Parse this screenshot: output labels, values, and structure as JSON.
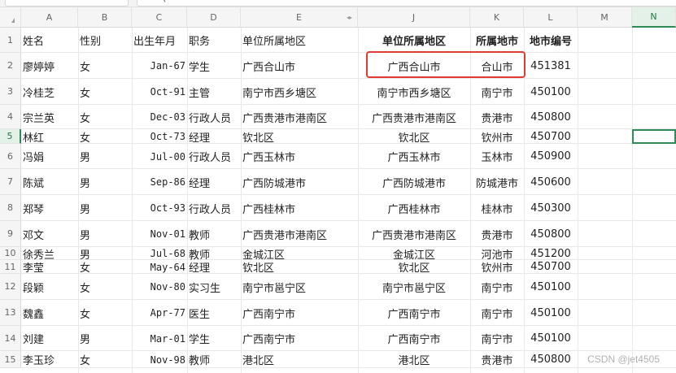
{
  "formula_bar": {
    "fragment": "("
  },
  "columns": [
    {
      "letter": "A"
    },
    {
      "letter": "B"
    },
    {
      "letter": "C"
    },
    {
      "letter": "D"
    },
    {
      "letter": "E"
    },
    {
      "letter": "J"
    },
    {
      "letter": "K"
    },
    {
      "letter": "L"
    },
    {
      "letter": "M"
    },
    {
      "letter": "N",
      "selected": true
    }
  ],
  "header": [
    "姓名",
    "性别",
    "出生年月",
    "职务",
    "单位所属地区",
    "单位所属地区",
    "所属地市",
    "地市编号"
  ],
  "rows": [
    {
      "num": "2",
      "name": "廖婷婷",
      "gender": "女",
      "birth": "Jan-67",
      "job": "学生",
      "unit": "广西合山市",
      "region": "广西合山市",
      "city": "合山市",
      "code": "451381"
    },
    {
      "num": "3",
      "name": "冷桂芝",
      "gender": "女",
      "birth": "Oct-91",
      "job": "主管",
      "unit": "南宁市西乡塘区",
      "region": "南宁市西乡塘区",
      "city": "南宁市",
      "code": "450100"
    },
    {
      "num": "4",
      "name": "宗兰英",
      "gender": "女",
      "birth": "Dec-03",
      "job": "行政人员",
      "unit": "广西贵港市港南区",
      "region": "广西贵港市港南区",
      "city": "贵港市",
      "code": "450800"
    },
    {
      "num": "5",
      "name": "林红",
      "gender": "女",
      "birth": "Oct-73",
      "job": "经理",
      "unit": "钦北区",
      "region": "钦北区",
      "city": "钦州市",
      "code": "450700",
      "selected": true
    },
    {
      "num": "6",
      "name": "冯娟",
      "gender": "男",
      "birth": "Jul-00",
      "job": "行政人员",
      "unit": "广西玉林市",
      "region": "广西玉林市",
      "city": "玉林市",
      "code": "450900"
    },
    {
      "num": "7",
      "name": "陈斌",
      "gender": "男",
      "birth": "Sep-86",
      "job": "经理",
      "unit": "广西防城港市",
      "region": "广西防城港市",
      "city": "防城港市",
      "code": "450600"
    },
    {
      "num": "8",
      "name": "郑琴",
      "gender": "男",
      "birth": "Oct-93",
      "job": "行政人员",
      "unit": "广西桂林市",
      "region": "广西桂林市",
      "city": "桂林市",
      "code": "450300"
    },
    {
      "num": "9",
      "name": "邓文",
      "gender": "男",
      "birth": "Nov-01",
      "job": "教师",
      "unit": "广西贵港市港南区",
      "region": "广西贵港市港南区",
      "city": "贵港市",
      "code": "450800"
    },
    {
      "num": "10",
      "name": "徐秀兰",
      "gender": "男",
      "birth": "Jul-68",
      "job": "教师",
      "unit": "金城江区",
      "region": "金城江区",
      "city": "河池市",
      "code": "451200"
    },
    {
      "num": "11",
      "name": "李莹",
      "gender": "女",
      "birth": "May-64",
      "job": "经理",
      "unit": "钦北区",
      "region": "钦北区",
      "city": "钦州市",
      "code": "450700"
    },
    {
      "num": "12",
      "name": "段颖",
      "gender": "女",
      "birth": "Nov-80",
      "job": "实习生",
      "unit": "南宁市邕宁区",
      "region": "南宁市邕宁区",
      "city": "南宁市",
      "code": "450100"
    },
    {
      "num": "13",
      "name": "魏鑫",
      "gender": "女",
      "birth": "Apr-77",
      "job": "医生",
      "unit": "广西南宁市",
      "region": "广西南宁市",
      "city": "南宁市",
      "code": "450100"
    },
    {
      "num": "14",
      "name": "刘建",
      "gender": "男",
      "birth": "Mar-01",
      "job": "学生",
      "unit": "广西南宁市",
      "region": "广西南宁市",
      "city": "南宁市",
      "code": "450100"
    },
    {
      "num": "15",
      "name": "李玉珍",
      "gender": "女",
      "birth": "Nov-98",
      "job": "教师",
      "unit": "港北区",
      "region": "港北区",
      "city": "贵港市",
      "code": "450800"
    }
  ],
  "watermark": "CSDN @jet4505",
  "colors": {
    "accent_green": "#2e8b57",
    "highlight_red": "#e53935"
  }
}
